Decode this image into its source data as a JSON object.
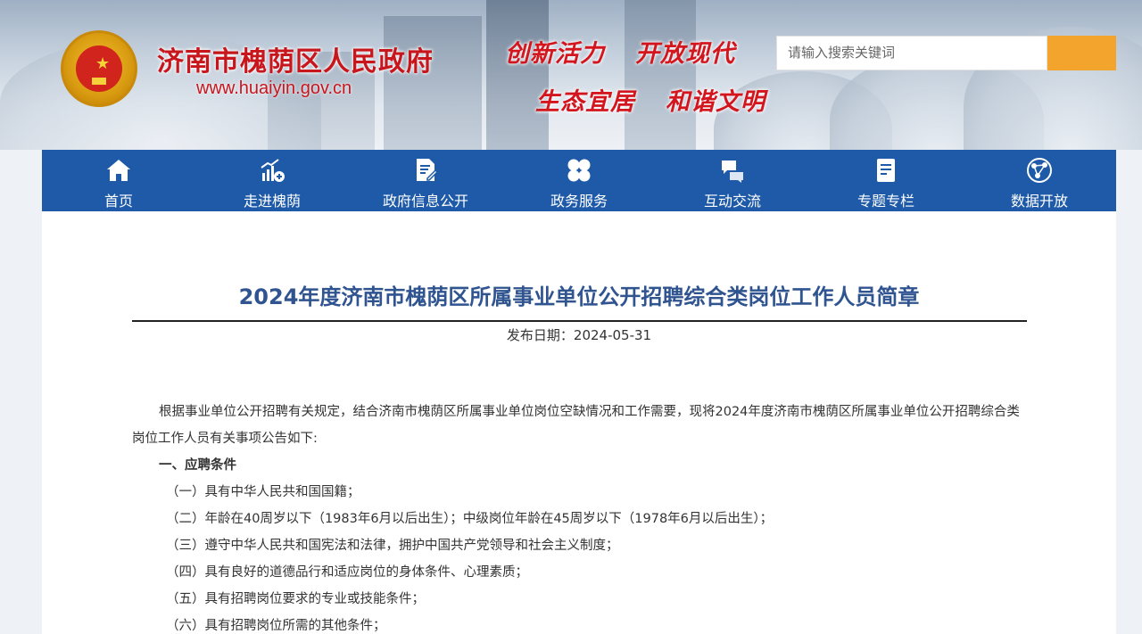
{
  "header": {
    "site_title": "济南市槐荫区人民政府",
    "site_url": "www.huaiyin.gov.cn",
    "slogans": [
      "创新活力",
      "开放现代",
      "生态宜居",
      "和谐文明"
    ],
    "search": {
      "placeholder": "请输入搜索关键词",
      "value": ""
    },
    "colors": {
      "title_red": "#c8161d",
      "search_button": "#f3a42d"
    }
  },
  "nav": {
    "background": "#1e5aa8",
    "items": [
      {
        "label": "首页",
        "icon": "home-icon"
      },
      {
        "label": "走进槐荫",
        "icon": "chart-growth-icon"
      },
      {
        "label": "政府信息公开",
        "icon": "document-edit-icon"
      },
      {
        "label": "政务服务",
        "icon": "clover-grid-icon"
      },
      {
        "label": "互动交流",
        "icon": "chat-bubbles-icon"
      },
      {
        "label": "专题专栏",
        "icon": "notes-icon"
      },
      {
        "label": "数据开放",
        "icon": "data-network-icon"
      }
    ]
  },
  "article": {
    "title": "2024年度济南市槐荫区所属事业单位公开招聘综合类岗位工作人员简章",
    "date_label": "发布日期：",
    "date": "2024-05-31",
    "intro": "根据事业单位公开招聘有关规定，结合济南市槐荫区所属事业单位岗位空缺情况和工作需要，现将2024年度济南市槐荫区所属事业单位公开招聘综合类岗位工作人员有关事项公告如下:",
    "section1_heading": "一、应聘条件",
    "conditions": [
      "（一）具有中华人民共和国国籍；",
      "（二）年龄在40周岁以下（1983年6月以后出生）；中级岗位年龄在45周岁以下（1978年6月以后出生）；",
      "（三）遵守中华人民共和国宪法和法律，拥护中国共产党领导和社会主义制度；",
      "（四）具有良好的道德品行和适应岗位的身体条件、心理素质；",
      "（五）具有招聘岗位要求的专业或技能条件；",
      "（六）具有招聘岗位所需的其他条件；"
    ]
  }
}
